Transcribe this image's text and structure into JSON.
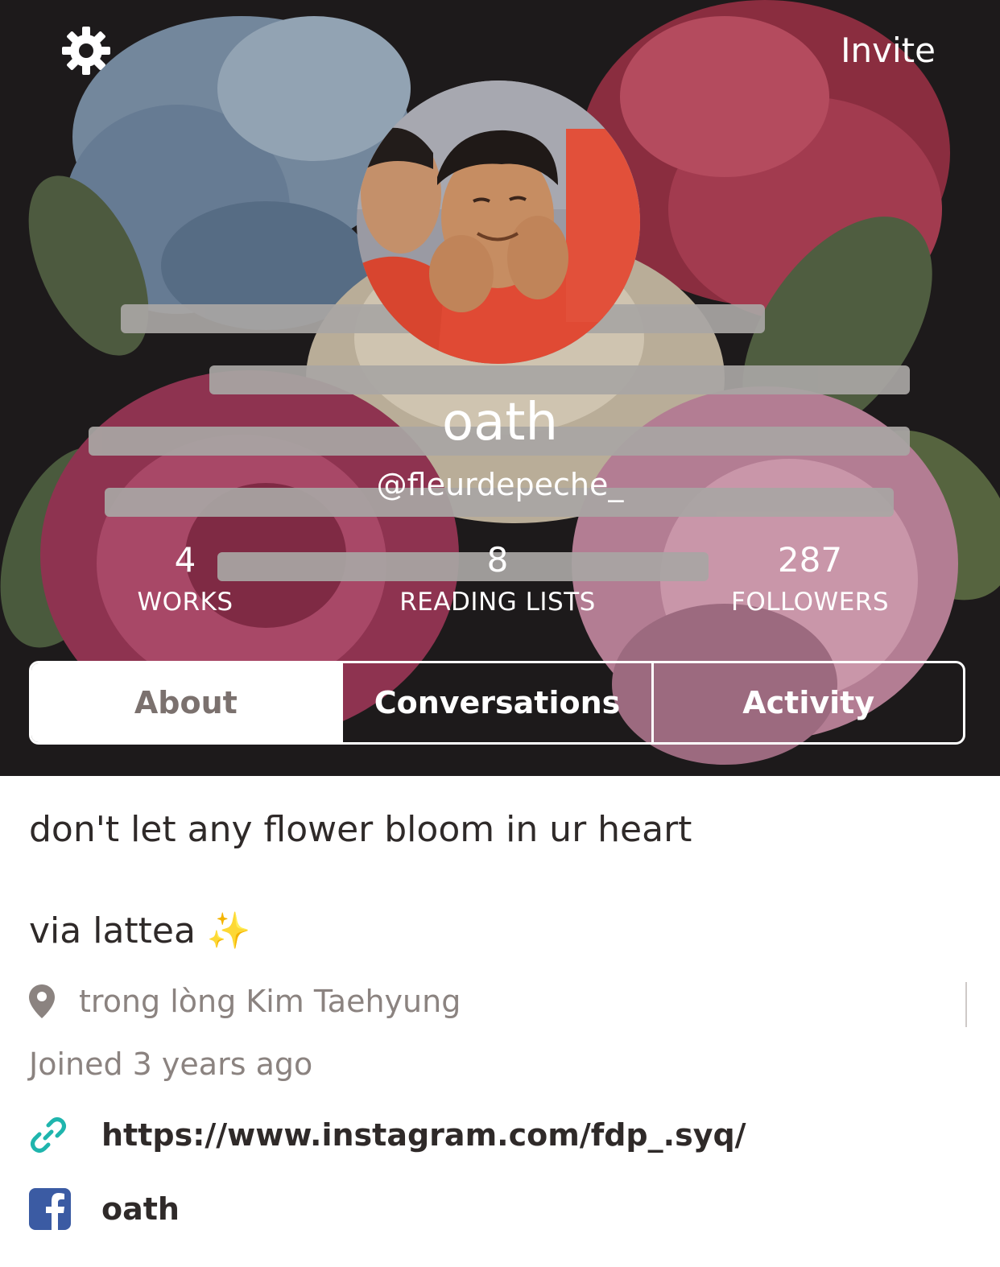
{
  "header": {
    "settings_icon": "gear-icon",
    "invite_label": "Invite",
    "display_name": "oath",
    "handle": "@fleurdepeche_",
    "background_color": "#1d1a1b"
  },
  "stats": [
    {
      "value": "4",
      "label": "WORKS"
    },
    {
      "value": "8",
      "label": "READING LISTS"
    },
    {
      "value": "287",
      "label": "FOLLOWERS"
    }
  ],
  "tabs": [
    {
      "label": "About",
      "active": true
    },
    {
      "label": "Conversations",
      "active": false
    },
    {
      "label": "Activity",
      "active": false
    }
  ],
  "about": {
    "bio_line1": "don't let any flower bloom in ur heart",
    "bio_line2": "via lattea ✨",
    "location": "trong lòng Kim Taehyung",
    "location_icon": "map-pin-icon",
    "joined": "Joined 3 years ago",
    "website": "https://www.instagram.com/fdp_.syq/",
    "website_icon": "link-icon",
    "facebook_name": "oath",
    "facebook_icon": "facebook-icon"
  },
  "colors": {
    "text_dark": "#2f2a29",
    "text_muted": "#8b8380",
    "link_icon": "#1fb5ad",
    "facebook_blue": "#3b5ba3",
    "active_tab_text": "#7b716e"
  }
}
